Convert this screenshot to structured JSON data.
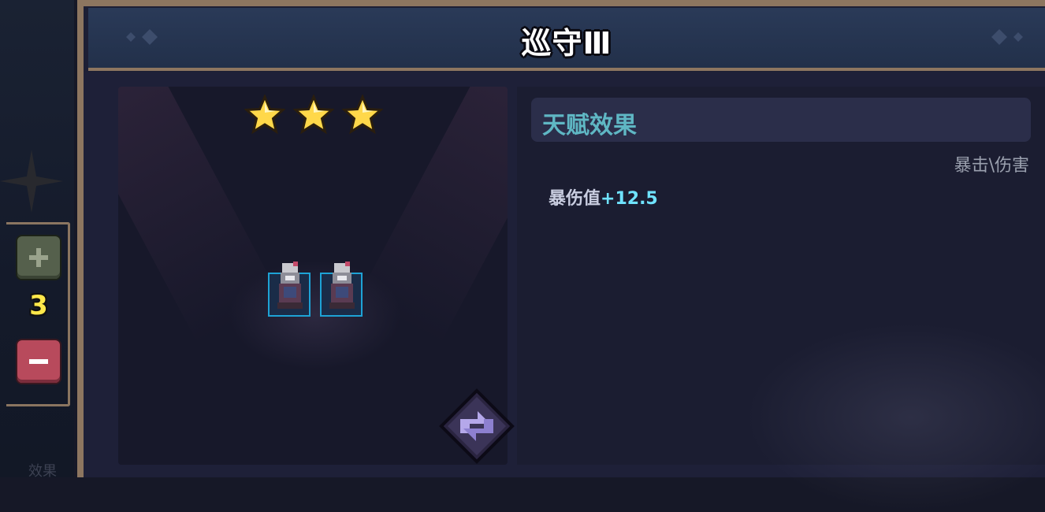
{
  "title": "巡守Ⅲ",
  "stepper": {
    "count": "3",
    "plus_icon": "plus-icon",
    "minus_icon": "minus-icon"
  },
  "left_footer_text": "效果",
  "stars": {
    "filled": 3,
    "total": 3
  },
  "units": [
    {
      "slot": 1
    },
    {
      "slot": 2
    }
  ],
  "talent": {
    "header": "天赋效果",
    "category": "暴击\\伤害",
    "stat_label": "暴伤值",
    "stat_value": "+12.5"
  },
  "colors": {
    "frame": "#8d7660",
    "header_text": "#5fb7c4",
    "stat_value": "#6fe3ff",
    "star": "#ffd84a",
    "slot_border": "#1ea3d6"
  },
  "icons": [
    "plus-icon",
    "minus-icon",
    "star-icon",
    "swap-icon",
    "sparkle-icon"
  ]
}
